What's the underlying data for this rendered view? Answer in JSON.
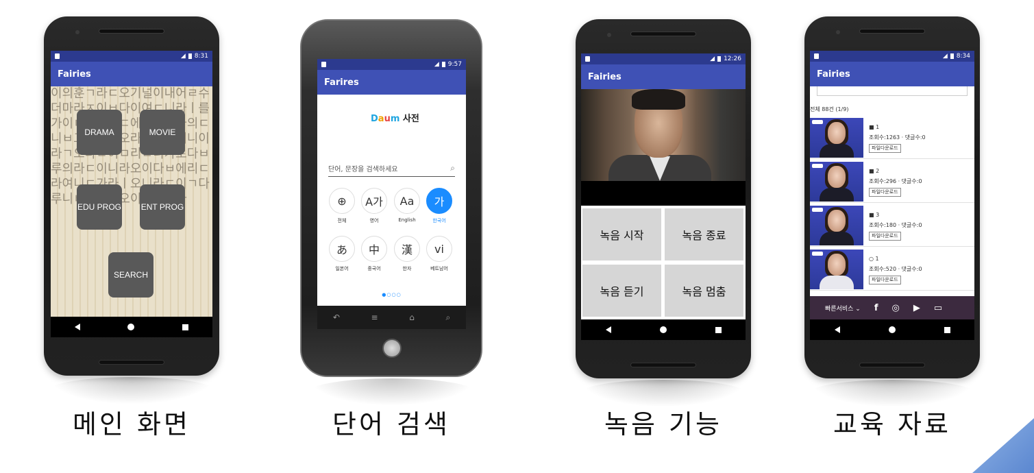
{
  "phones": {
    "main": {
      "status_time": "8:31",
      "app_title": "Fairies",
      "buttons": {
        "drama": "DRAMA",
        "movie": "MOVIE",
        "edu": "EDU PROG",
        "ent": "ENT PROG",
        "search": "SEARCH"
      },
      "caption": "메인 화면"
    },
    "dictionary": {
      "status_time": "9:57",
      "app_title": "Farires",
      "logo_text": "사전",
      "search_placeholder": "단어, 문장을 검색하세요",
      "languages": [
        {
          "glyph": "⊕",
          "label": "전체"
        },
        {
          "glyph": "A가",
          "label": "영어"
        },
        {
          "glyph": "Aa",
          "label": "English"
        },
        {
          "glyph": "가",
          "label": "한국어"
        },
        {
          "glyph": "あ",
          "label": "일본어"
        },
        {
          "glyph": "中",
          "label": "중국어"
        },
        {
          "glyph": "漢",
          "label": "한자"
        },
        {
          "glyph": "vi",
          "label": "베트남어"
        }
      ],
      "caption": "단어 검색"
    },
    "recording": {
      "status_time": "12:26",
      "app_title": "Fairies",
      "buttons": {
        "start": "녹음 시작",
        "stop": "녹음 종료",
        "listen": "녹음 듣기",
        "pause": "녹음 멈춤"
      },
      "caption": "녹음 기능"
    },
    "materials": {
      "status_time": "8:34",
      "app_title": "Fairies",
      "total": "전체 88건 (1/9)",
      "items": [
        {
          "no": "1",
          "stats": "조회수:1263 · 댓글수:0",
          "download": "파일다운로드"
        },
        {
          "no": "2",
          "stats": "조회수:296 · 댓글수:0",
          "download": "파일다운로드"
        },
        {
          "no": "3",
          "stats": "조회수:180 · 댓글수:0",
          "download": "파일다운로드"
        },
        {
          "no": "1",
          "stats": "조회수:520 · 댓글수:0",
          "download": "파일다운로드"
        }
      ],
      "quick_service": "빠른서비스",
      "caption": "교육 자료"
    }
  },
  "colors": {
    "appbar": "#3f51b5",
    "status": "#2c3a8f",
    "accent": "#1a8cff"
  }
}
